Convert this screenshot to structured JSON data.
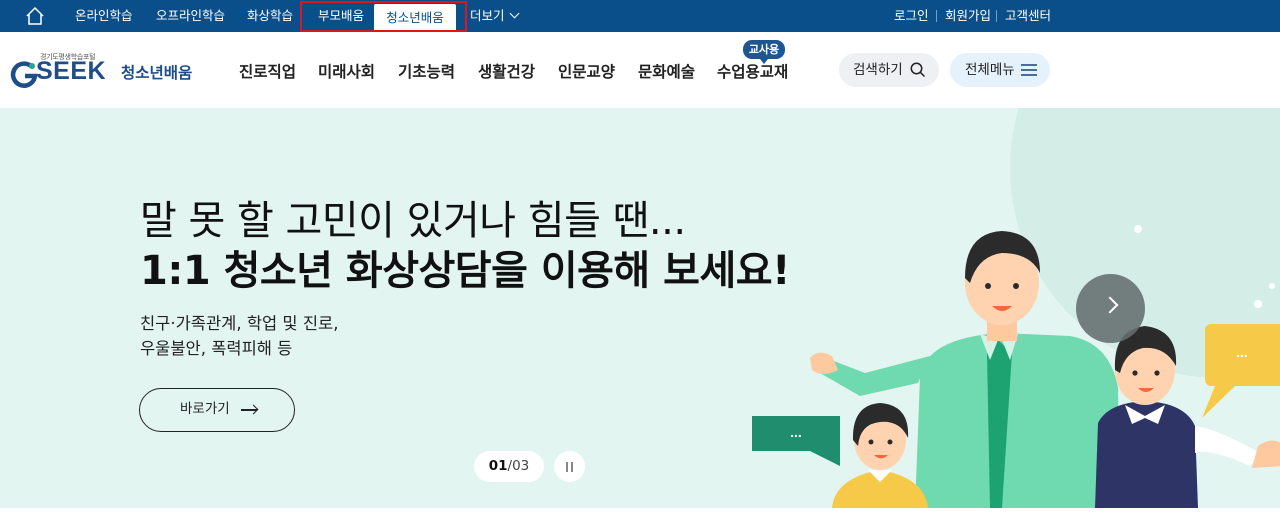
{
  "topbar": {
    "home_icon": "home-icon",
    "nav": [
      "온라인학습",
      "오프라인학습",
      "화상학습",
      "부모배움",
      "청소년배움",
      "더보기"
    ],
    "active_tab": "청소년배움",
    "util": [
      "로그인",
      "회원가입",
      "고객센터"
    ]
  },
  "header": {
    "logo_small": "경기도평생학습포털",
    "logo_text": "SEEK",
    "logo_sub": "청소년배움",
    "gnb": [
      "진로직업",
      "미래사회",
      "기초능력",
      "생활건강",
      "인문교양",
      "문화예술",
      "수업용교재"
    ],
    "teacher_badge": "교사용",
    "search_label": "검색하기",
    "allmenu_label": "전체메뉴"
  },
  "hero": {
    "title_line1": "말 못 할 고민이 있거나 힘들 땐...",
    "title_line2": "1:1 청소년 화상상담을 이용해 보세요!",
    "desc_line1": "친구·가족관계, 학업 및 진로,",
    "desc_line2": "우울불안, 폭력피해 등",
    "go_button": "바로가기",
    "pager_current": "01",
    "pager_total": "/03",
    "bubble_text": "...",
    "colors": {
      "bg": "#e3f5f0",
      "topbar": "#0a4f8a",
      "highlight": "#e0141e"
    }
  }
}
